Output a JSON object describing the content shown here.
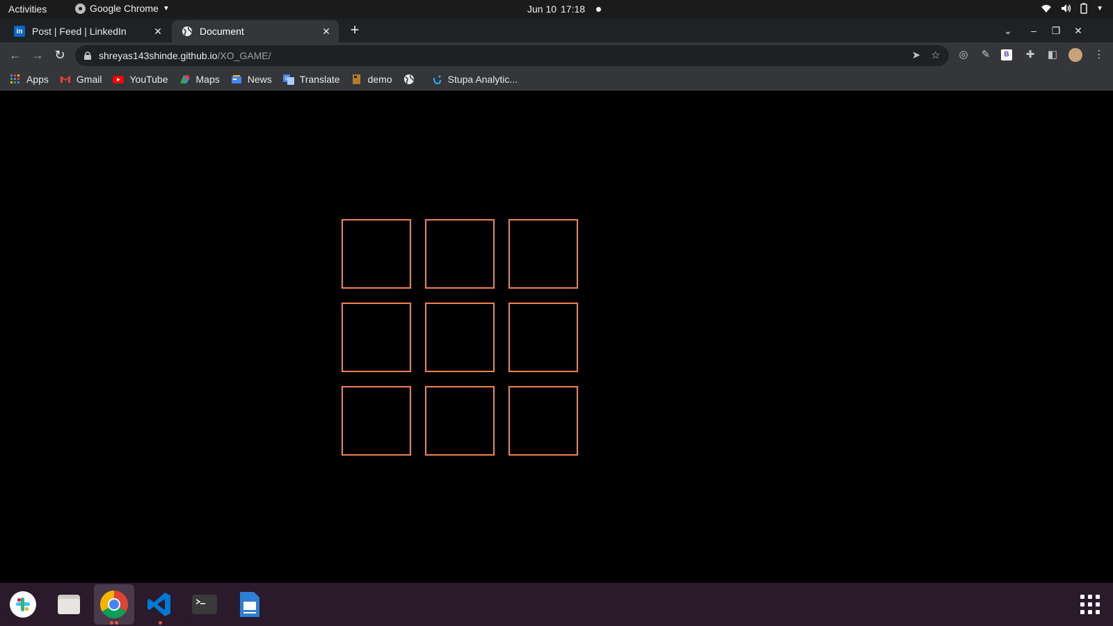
{
  "system": {
    "activities": "Activities",
    "app_name": "Google Chrome",
    "date": "Jun 10",
    "time": "17:18"
  },
  "tabs": [
    {
      "title": "Post | Feed | LinkedIn",
      "icon": "linkedin-icon",
      "active": false
    },
    {
      "title": "Document",
      "icon": "globe-icon",
      "active": true
    }
  ],
  "address": {
    "host": "shreyas143shinde.github.io",
    "path": "/XO_GAME/"
  },
  "bookmarks": [
    {
      "label": "Apps",
      "icon": "apps-grid-icon"
    },
    {
      "label": "Gmail",
      "icon": "gmail-icon"
    },
    {
      "label": "YouTube",
      "icon": "youtube-icon"
    },
    {
      "label": "Maps",
      "icon": "maps-icon"
    },
    {
      "label": "News",
      "icon": "news-icon"
    },
    {
      "label": "Translate",
      "icon": "translate-icon"
    },
    {
      "label": "demo",
      "icon": "bookmark-page-icon"
    },
    {
      "label": "",
      "icon": "globe-icon"
    },
    {
      "label": "Stupa Analytic...",
      "icon": "stupa-icon"
    }
  ],
  "game": {
    "cells": [
      "",
      "",
      "",
      "",
      "",
      "",
      "",
      "",
      ""
    ],
    "cell_border_color": "#f08050",
    "background": "#000000"
  },
  "dock": [
    {
      "name": "slack-icon",
      "running": false
    },
    {
      "name": "files-icon",
      "running": false
    },
    {
      "name": "chrome-icon",
      "running": true
    },
    {
      "name": "vscode-icon",
      "running": true
    },
    {
      "name": "terminal-icon",
      "running": false
    },
    {
      "name": "text-editor-icon",
      "running": false
    }
  ]
}
